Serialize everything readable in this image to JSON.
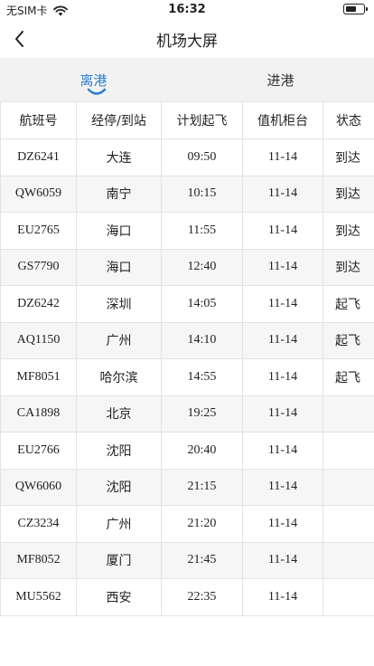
{
  "status_bar": {
    "carrier": "无SIM卡",
    "time": "16:32",
    "battery_level": 0.65
  },
  "nav": {
    "title": "机场大屏",
    "back_icon": "chevron-left-icon"
  },
  "tabs": [
    {
      "label": "离港",
      "active": true
    },
    {
      "label": "进港",
      "active": false
    }
  ],
  "colors": {
    "accent": "#2f80d1",
    "tab_bar_bg": "#f2f2f2",
    "row_alt_bg": "#f6f6f6",
    "border": "#e3e3e3"
  },
  "table": {
    "headers": [
      "航班号",
      "经停/到站",
      "计划起飞",
      "值机柜台",
      "状态"
    ],
    "rows": [
      [
        "DZ6241",
        "大连",
        "09:50",
        "11-14",
        "到达"
      ],
      [
        "QW6059",
        "南宁",
        "10:15",
        "11-14",
        "到达"
      ],
      [
        "EU2765",
        "海口",
        "11:55",
        "11-14",
        "到达"
      ],
      [
        "GS7790",
        "海口",
        "12:40",
        "11-14",
        "到达"
      ],
      [
        "DZ6242",
        "深圳",
        "14:05",
        "11-14",
        "起飞"
      ],
      [
        "AQ1150",
        "广州",
        "14:10",
        "11-14",
        "起飞"
      ],
      [
        "MF8051",
        "哈尔滨",
        "14:55",
        "11-14",
        "起飞"
      ],
      [
        "CA1898",
        "北京",
        "19:25",
        "11-14",
        ""
      ],
      [
        "EU2766",
        "沈阳",
        "20:40",
        "11-14",
        ""
      ],
      [
        "QW6060",
        "沈阳",
        "21:15",
        "11-14",
        ""
      ],
      [
        "CZ3234",
        "广州",
        "21:20",
        "11-14",
        ""
      ],
      [
        "MF8052",
        "厦门",
        "21:45",
        "11-14",
        ""
      ],
      [
        "MU5562",
        "西安",
        "22:35",
        "11-14",
        ""
      ]
    ]
  }
}
